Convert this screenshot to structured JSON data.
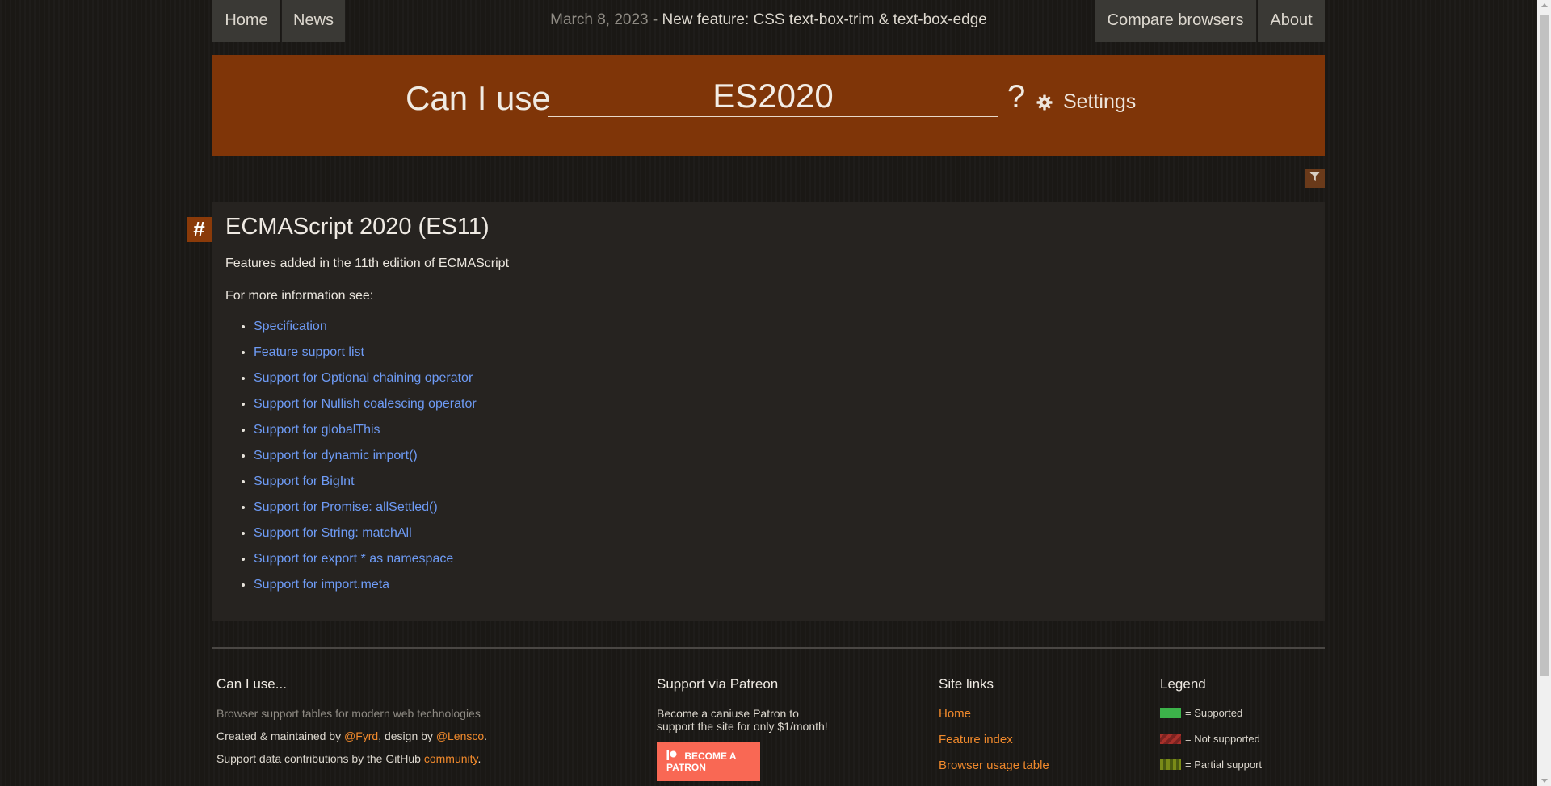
{
  "nav": {
    "home": "Home",
    "news": "News",
    "compare": "Compare browsers",
    "about": "About"
  },
  "news": {
    "date": "March 8, 2023",
    "separator": " - ",
    "headline": "New feature: CSS text-box-trim & text-box-edge"
  },
  "search": {
    "prefix": "Can I use",
    "value": "ES2020",
    "question_mark": "?",
    "settings_label": "Settings"
  },
  "feature": {
    "anchor": "#",
    "title": "ECMAScript 2020 (ES11)",
    "description": "Features added in the 11th edition of ECMAScript",
    "more_info": "For more information see:",
    "links": [
      "Specification",
      "Feature support list",
      "Support for Optional chaining operator",
      "Support for Nullish coalescing operator",
      "Support for globalThis",
      "Support for dynamic import()",
      "Support for BigInt",
      "Support for Promise: allSettled()",
      "Support for String: matchAll",
      "Support for export * as namespace",
      "Support for import.meta"
    ]
  },
  "footer": {
    "col1": {
      "title": "Can I use...",
      "tagline": "Browser support tables for modern web technologies",
      "created_prefix": "Created & maintained by ",
      "created_link": "@Fyrd",
      "design_text": ", design by ",
      "design_link": "@Lensco",
      "design_suffix": ".",
      "support_prefix": "Support data contributions by the GitHub ",
      "support_link": "community",
      "support_suffix": "."
    },
    "col2": {
      "title": "Support via Patreon",
      "text_line1": "Become a caniuse Patron to",
      "text_line2": "support the site for only $1/month!",
      "button": "BECOME A PATRON"
    },
    "col3": {
      "title": "Site links",
      "links": [
        "Home",
        "Feature index",
        "Browser usage table"
      ]
    },
    "col4": {
      "title": "Legend",
      "items": [
        "= Supported",
        "= Not supported",
        "= Partial support"
      ]
    }
  },
  "colors": {
    "banner": "#7f3508",
    "link": "#6e9bf5",
    "accent": "#f0892c"
  }
}
